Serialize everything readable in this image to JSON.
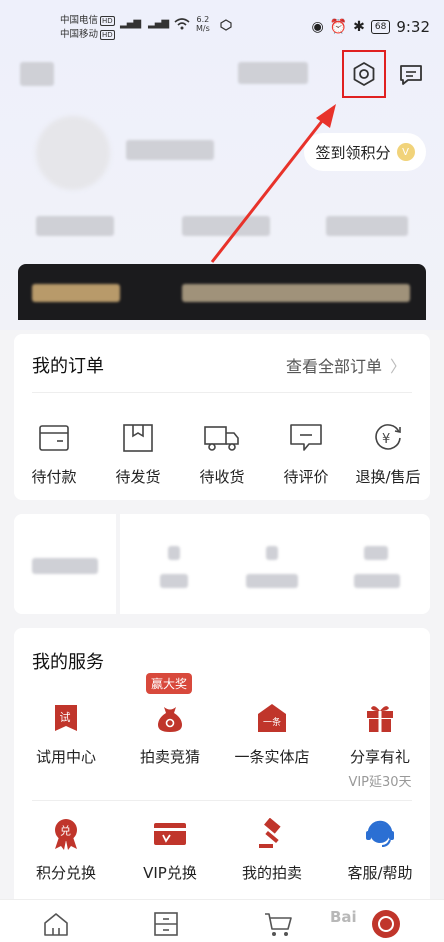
{
  "status_bar": {
    "carrier1": "中国电信",
    "carrier2": "中国移动",
    "hd": "HD",
    "net_speed_value": "6.2",
    "net_speed_unit": "M/s",
    "battery": "68",
    "time": "9:32"
  },
  "header": {
    "sign_in_label": "签到领积分",
    "coin_symbol": "V"
  },
  "orders": {
    "title": "我的订单",
    "view_all": "查看全部订单",
    "items": [
      "待付款",
      "待发货",
      "待收货",
      "待评价",
      "退换/售后"
    ]
  },
  "services": {
    "title": "我的服务",
    "badge": "赢大奖",
    "items": [
      {
        "label": "试用中心",
        "icon": "trial-icon",
        "glyph": "试"
      },
      {
        "label": "拍卖竞猜",
        "icon": "auction-bag-icon",
        "glyph": ""
      },
      {
        "label": "一条实体店",
        "icon": "store-icon",
        "glyph": "一条"
      },
      {
        "label": "分享有礼",
        "icon": "gift-icon",
        "glyph": "",
        "sub": "VIP延30天"
      },
      {
        "label": "积分兑换",
        "icon": "points-icon",
        "glyph": "兑"
      },
      {
        "label": "VIP兑换",
        "icon": "vip-card-icon",
        "glyph": ""
      },
      {
        "label": "我的拍卖",
        "icon": "gavel-icon",
        "glyph": ""
      },
      {
        "label": "客服/帮助",
        "icon": "headset-icon",
        "glyph": ""
      }
    ]
  },
  "watermark": "Bai",
  "colors": {
    "accent": "#c0352b",
    "highlight": "#e02020",
    "hero_bg": "#eef0fb"
  }
}
